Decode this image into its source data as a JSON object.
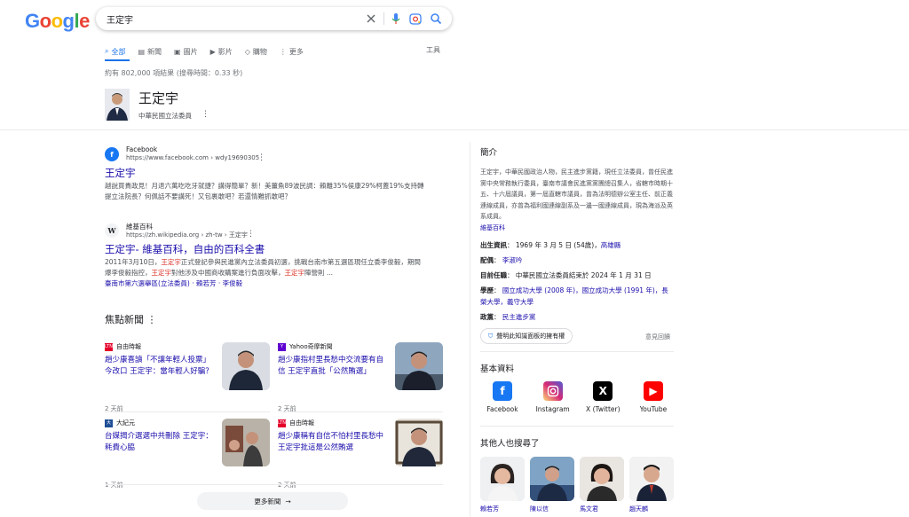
{
  "logo": "Google",
  "search": {
    "query": "王定宇"
  },
  "tabs": [
    {
      "label": "全部"
    },
    {
      "label": "新聞"
    },
    {
      "label": "圖片"
    },
    {
      "label": "影片"
    },
    {
      "label": "購物"
    },
    {
      "label": "更多"
    }
  ],
  "tools_label": "工具",
  "stats": "約有 802,000 項結果 (搜尋時間：0.33 秒)",
  "entity": {
    "name": "王定宇",
    "subtitle": "中華民國立法委員"
  },
  "results": [
    {
      "site": "Facebook",
      "url": "https://www.facebook.com › wdy19690305",
      "title": "王定宇",
      "snippet": "越說買貴政見！月退六萬吃吃牙就捷？講得簡單？新！美薑魚89波民調：賴離35%侯康29%柯蓋19%支持轉提立法院長？何佩話不要講死！又包裹敢吧？若還情難抓敢吧？"
    },
    {
      "site": "維基百科",
      "url": "https://zh.wikipedia.org › zh-tw › 王定宇",
      "title": "王定宇- 維基百科，自由的百科全書",
      "snippet_a": "2011年3月10日，",
      "snippet_hl1": "王定宇",
      "snippet_b": "正式登記參與民進黨內立法委員初選，挑戰台南市第五選區現任立委李俊毅，期間爆李俊毅指控，",
      "snippet_hl2": "王定宇",
      "snippet_c": "對他涉及中國商收購案進行負面攻擊，",
      "snippet_hl3": "王定宇",
      "snippet_d": "陣營則 ...",
      "links": "臺南市第六選舉區(立法委員) · 賴若芳 · 李俊毅"
    }
  ],
  "news": {
    "heading": "焦點新聞",
    "items": [
      {
        "source": "自由時報",
        "title": "趙少康喜讀「不讓年輕人投票」今改口 王定宇：當年輕人好騙？",
        "time": "2 天前"
      },
      {
        "source": "Yahoo奇摩新聞",
        "title": "趙少康指村里長愁中交流要有自信 王定宇直批「公然賄選」",
        "time": "2 天前"
      },
      {
        "source": "大紀元",
        "title": "台媒揭介選選中共刪除 王定宇：耗費心脇",
        "time": "1 天前"
      },
      {
        "source": "自由時報",
        "title": "趙少康稱有自信不怕村里長愁中 王定宇批這是公然賄選",
        "time": "2 天前"
      }
    ],
    "more_label": "更多新聞"
  },
  "knowledge_panel": {
    "intro_heading": "簡介",
    "description": "王定宇，中華民國政治人物，民主進步黨籍，現任立法委員，曾任民進黨中央常務執行委員，臺南市議會民進黨黨團總召集人，省轄市時期十五、十六屆議員，第一屆直轄市議員，曾為法明德辦公室主任、前正義連線成員，亦曾為福利國連線副系及一邊一國連線成員，現為海派及英系成員。",
    "source_link": "維基百科",
    "facts": [
      {
        "label": "出生資訊",
        "value": "1969 年 3 月 5 日 (54歲)，",
        "link": "高雄縣"
      },
      {
        "label": "配偶",
        "value": "",
        "link": "李淑吟"
      },
      {
        "label": "目前任職",
        "value": "中華民國立法委員結束於 2024 年 1 月 31 日",
        "link": ""
      },
      {
        "label": "學歷",
        "value": "",
        "link": "國立成功大學 (2008 年)，國立成功大學 (1991 年)，長榮大學，義守大學"
      },
      {
        "label": "政黨",
        "value": "",
        "link": "民主進步黨"
      }
    ],
    "claim_label": "聲明此知識面板的擁有權",
    "feedback_label": "意見回饋",
    "profiles_heading": "基本資料",
    "profiles": [
      {
        "name": "Facebook",
        "icon": "facebook-icon",
        "color": "#1877f2"
      },
      {
        "name": "Instagram",
        "icon": "instagram-icon",
        "color": "#d6249f"
      },
      {
        "name": "X (Twitter)",
        "icon": "x-icon",
        "color": "#000000"
      },
      {
        "name": "YouTube",
        "icon": "youtube-icon",
        "color": "#ff0000"
      }
    ],
    "people_heading": "其他人也搜尋了",
    "people": [
      {
        "name": "賴若芳"
      },
      {
        "name": "陳以信"
      },
      {
        "name": "馬文君"
      },
      {
        "name": "趙天麟"
      }
    ]
  }
}
